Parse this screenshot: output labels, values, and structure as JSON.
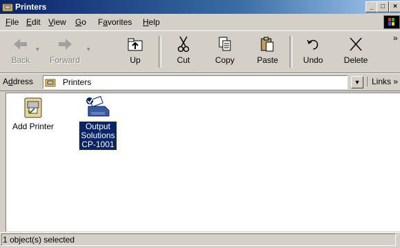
{
  "window": {
    "title": "Printers",
    "minimize": "_",
    "maximize": "□",
    "close": "×"
  },
  "menu": [
    {
      "label": "File",
      "accel": "F",
      "rest": "ile"
    },
    {
      "label": "Edit",
      "accel": "E",
      "rest": "dit"
    },
    {
      "label": "View",
      "accel": "V",
      "rest": "iew"
    },
    {
      "label": "Go",
      "accel": "G",
      "rest": "o"
    },
    {
      "label": "Favorites",
      "accel": "a",
      "pre": "F",
      "rest": "vorites"
    },
    {
      "label": "Help",
      "accel": "H",
      "rest": "elp"
    }
  ],
  "toolbar": {
    "back": "Back",
    "forward": "Forward",
    "up": "Up",
    "cut": "Cut",
    "copy": "Copy",
    "paste": "Paste",
    "undo": "Undo",
    "delete": "Delete",
    "more": "»"
  },
  "address": {
    "label": "Address",
    "value": "Printers",
    "links": "Links »"
  },
  "items": [
    {
      "label": "Add Printer",
      "icon": "add-printer-icon",
      "selected": false
    },
    {
      "label_lines": [
        "Output",
        "Solutions",
        "CP-1001"
      ],
      "icon": "printer-icon",
      "selected": true
    }
  ],
  "status": {
    "text": "1 object(s) selected"
  },
  "colors": {
    "titlebar": "#0a246a",
    "face": "#d4d0c8",
    "selection": "#0a246a"
  }
}
